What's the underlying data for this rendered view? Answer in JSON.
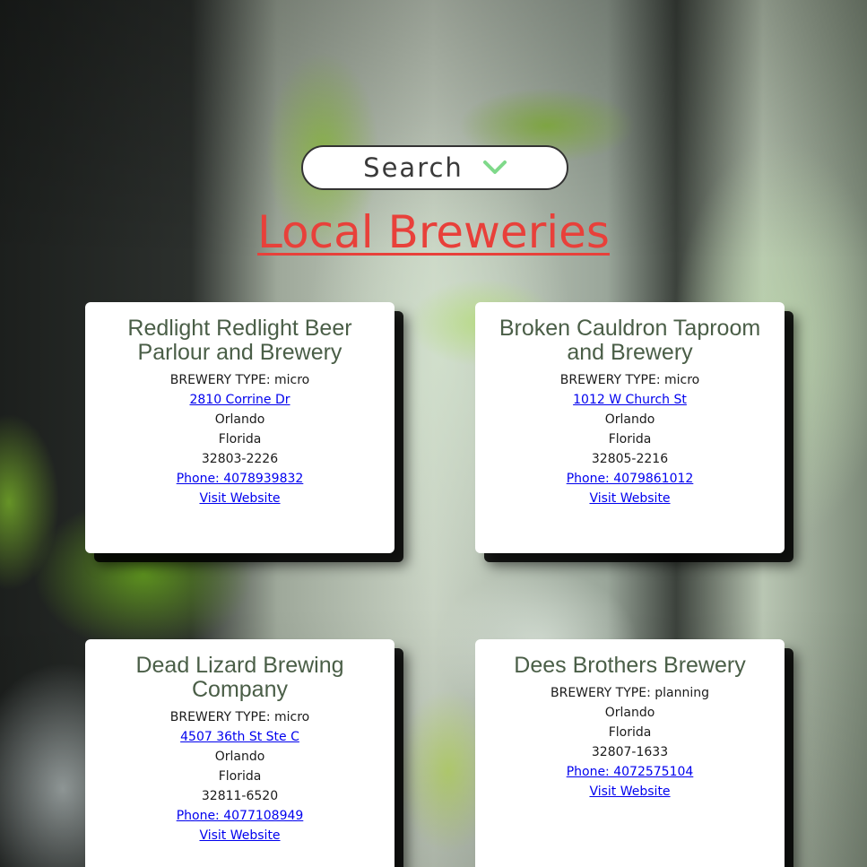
{
  "colors": {
    "title": "#e8403a",
    "card_name": "#4a5e47",
    "link": "#0000ee",
    "chevron": "#7fd98a"
  },
  "search": {
    "label": "Search",
    "icon": "chevron-down-icon"
  },
  "page": {
    "title": "Local Breweries"
  },
  "breweries": [
    {
      "name": "Redlight Redlight Beer Parlour and Brewery",
      "type_prefix": "BREWERY TYPE: ",
      "type_line": "BREWERY TYPE: micro",
      "street": "2810 Corrine Dr",
      "city": "Orlando",
      "state": "Florida",
      "postal": "32803-2226",
      "phone": "Phone: 4078939832",
      "website": "Visit Website"
    },
    {
      "name": "Broken Cauldron Taproom and Brewery",
      "type_line": "BREWERY TYPE: micro",
      "street": "1012 W Church St",
      "city": "Orlando",
      "state": "Florida",
      "postal": "32805-2216",
      "phone": "Phone: 4079861012",
      "website": "Visit Website"
    },
    {
      "name": "Dead Lizard Brewing Company",
      "type_line": "BREWERY TYPE: micro",
      "street": "4507 36th St Ste C",
      "city": "Orlando",
      "state": "Florida",
      "postal": "32811-6520",
      "phone": "Phone: 4077108949",
      "website": "Visit Website"
    },
    {
      "name": "Dees Brothers Brewery",
      "type_line": "BREWERY TYPE: planning",
      "city": "Orlando",
      "state": "Florida",
      "postal": "32807-1633",
      "phone": "Phone: 4072575104",
      "website": "Visit Website"
    }
  ]
}
